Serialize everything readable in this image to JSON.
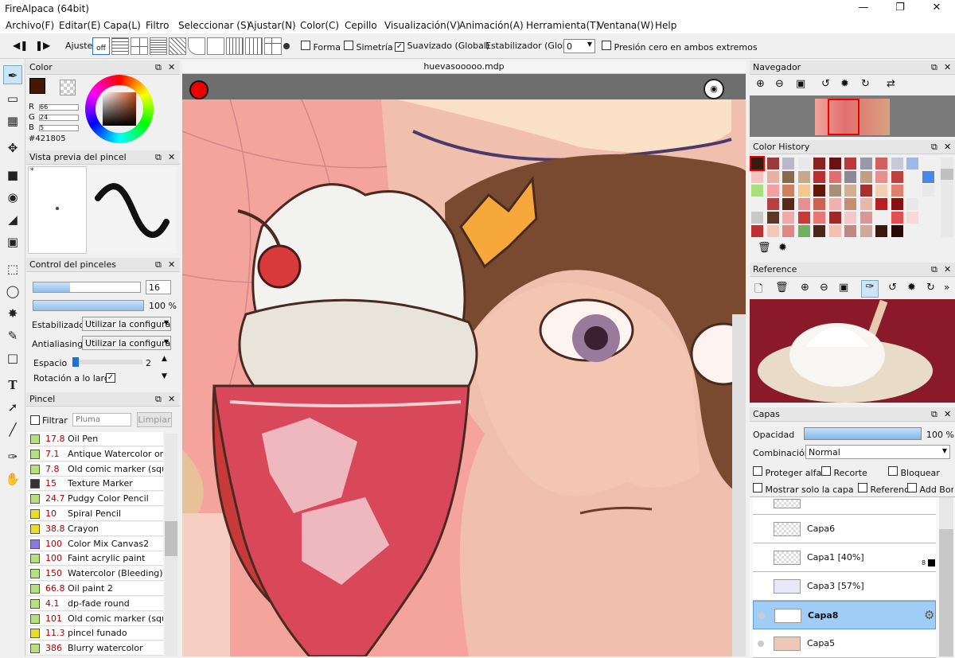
{
  "window": {
    "title": "FireAlpaca (64bit)",
    "minimize": "—",
    "maximize": "❐",
    "close": "✕"
  },
  "menu": [
    "Archivo(F)",
    "Editar(E)",
    "Capa(L)",
    "Filtro",
    "Seleccionar (S)",
    "Ajustar(N)",
    "Color(C)",
    "Cepillo",
    "Visualización(V)",
    "Animación(A)",
    "Herramienta(T)",
    "Ventana(W)",
    "Help"
  ],
  "toolbar": {
    "ajuste": "Ajuste",
    "off": "off",
    "forma": "Forma",
    "simetria": "Simetría",
    "suavizado": "Suavizado (Global)",
    "estabilizador": "Estabilizador (Global)",
    "estab_value": "0",
    "presion": "Presión cero en ambos extremos"
  },
  "color_panel": {
    "title": "Color",
    "r_label": "R",
    "r": "66",
    "g_label": "G",
    "g": "24",
    "b_label": "B",
    "b": "5",
    "hex": "#421805",
    "fg": "#421805"
  },
  "brush_preview": {
    "title": "Vista previa del pincel",
    "star": "*"
  },
  "brush_control": {
    "title": "Control del pinceles",
    "size": "16",
    "opacity": "100 %",
    "stab_label": "Estabilizador",
    "stab_value": "Utilizar la configuraci",
    "aa_label": "Antialiasing",
    "aa_value": "Utilizar la configuraci",
    "space_label": "Espacio",
    "space_value": "2",
    "rotation_label": "Rotación a lo largo"
  },
  "brush_list": {
    "title": "Pincel",
    "filter": "Filtrar",
    "filter_placeholder": "Pluma",
    "clear": "Limpiar",
    "items": [
      {
        "size": "17.8",
        "name": "Oil Pen",
        "color": "#b6e07a"
      },
      {
        "size": "7.1",
        "name": "Antique Watercolor on Pa",
        "color": "#b6e07a"
      },
      {
        "size": "7.8",
        "name": "Old comic marker (squar",
        "color": "#b6e07a"
      },
      {
        "size": "15",
        "name": "Texture Marker",
        "color": "#333333"
      },
      {
        "size": "24.7",
        "name": "Pudgy Color Pencil",
        "color": "#b6e07a"
      },
      {
        "size": "10",
        "name": "Spiral Pencil",
        "color": "#e8e020"
      },
      {
        "size": "38.8",
        "name": "Crayon",
        "color": "#e8e020"
      },
      {
        "size": "100",
        "name": "Color Mix Canvas2",
        "color": "#8878e8"
      },
      {
        "size": "100",
        "name": "Faint acrylic paint",
        "color": "#b6e07a"
      },
      {
        "size": "150",
        "name": "Watercolor (Bleeding)",
        "color": "#b6e07a"
      },
      {
        "size": "66.8",
        "name": "Oil paint 2",
        "color": "#b6e07a"
      },
      {
        "size": "4.1",
        "name": "dp-fade round",
        "color": "#b6e07a"
      },
      {
        "size": "101",
        "name": "Old comic marker (squar",
        "color": "#b6e07a"
      },
      {
        "size": "11.3",
        "name": "pincel funado",
        "color": "#e8e020"
      },
      {
        "size": "386",
        "name": "Blurry watercolor",
        "color": "#b6e07a"
      }
    ]
  },
  "canvas": {
    "filename": "huevasooooo.mdp"
  },
  "navigator": {
    "title": "Navegador"
  },
  "color_history": {
    "title": "Color History",
    "colors": [
      "#3a1a10",
      "#9a3a3a",
      "#b8b8c8",
      "#e8e8e8",
      "#8a2020",
      "#6a1010",
      "#b83a3a",
      "#9898a8",
      "#d06060",
      "#c8c8d8",
      "#a0b8e8",
      "#f0f0f0",
      "#f4c4c4",
      "#e8b0a0",
      "#8a6a4a",
      "#c8a888",
      "#b83030",
      "#e07070",
      "#8a8a98",
      "#c0a080",
      "#e89090",
      "#c04040",
      "#f0f0f0",
      "#4a88e8",
      "#a8e080",
      "#f4a0a0",
      "#d08060",
      "#f0c890",
      "#601808",
      "#a89078",
      "#d0b090",
      "#a83030",
      "#f0d0b0",
      "#e08070",
      "#f0f0f0",
      "#e8e8e8",
      "#f0f0f0",
      "#b84040",
      "#5a2a18",
      "#e89090",
      "#d06050",
      "#f0b0b0",
      "#c09070",
      "#e8b8a8",
      "#b82020",
      "#8a1010",
      "#e8e8e8",
      "#f0f0f0",
      "#c8c8c8",
      "#5a3828",
      "#f0a8a8",
      "#c83a3a",
      "#e87878",
      "#a02828",
      "#f4c8c8",
      "#d89898",
      "#f0f0f0",
      "#e05050",
      "#f8d8d8",
      "#f0f0f0",
      "#c03030",
      "#f4c8b8",
      "#e08888",
      "#70b060",
      "#4a2818",
      "#f4c0b0",
      "#c08880",
      "#d0a898",
      "#3a1810",
      "#2a0808",
      "#f0f0f0",
      "#f0f0f0"
    ]
  },
  "reference": {
    "title": "Reference"
  },
  "layers": {
    "title": "Capas",
    "opacity_label": "Opacidad",
    "opacity": "100 %",
    "blend_label": "Combinación",
    "blend": "Normal",
    "protect": "Proteger alfa",
    "clip": "Recorte",
    "lock": "Bloquear",
    "show_only": "Mostrar solo la capa acti",
    "refer": "Referenc",
    "add_border": "Add Bor",
    "items": [
      {
        "name": "Capa6"
      },
      {
        "name": "Capa1 [40%]",
        "badge": "8"
      },
      {
        "name": "Capa3 [57%]"
      },
      {
        "name": "Capa8"
      },
      {
        "name": "Capa5"
      }
    ]
  }
}
